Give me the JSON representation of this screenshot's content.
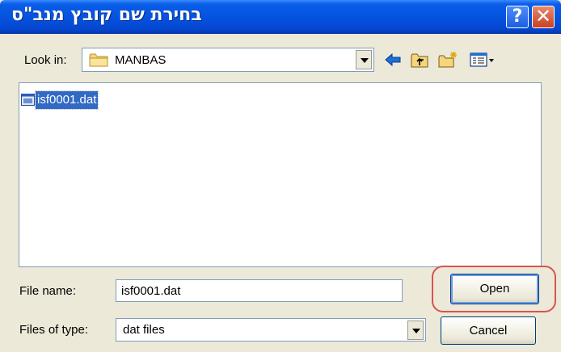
{
  "window": {
    "title": "בחירת שם קובץ מנב\"ס",
    "help_label": "?",
    "close_label": "✕"
  },
  "lookin": {
    "label": "Look in:",
    "value": "MANBAS"
  },
  "toolbar": {
    "icons": [
      "back-arrow-icon",
      "up-one-level-icon",
      "new-folder-icon",
      "views-menu-icon"
    ]
  },
  "files": [
    {
      "name": "isf0001.dat",
      "selected": true
    }
  ],
  "filename": {
    "label": "File name:",
    "value": "isf0001.dat"
  },
  "filetype": {
    "label": "Files of type:",
    "value": "dat files"
  },
  "buttons": {
    "open": "Open",
    "cancel": "Cancel"
  },
  "colors": {
    "titlebar": "#0553df",
    "selection": "#316ac5",
    "highlight_ring": "#d9534f"
  }
}
